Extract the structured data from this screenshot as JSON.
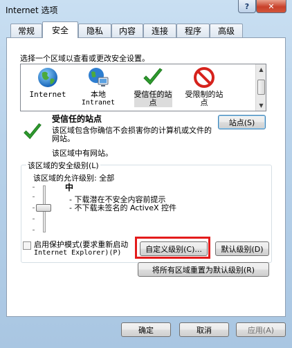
{
  "window": {
    "title": "Internet 选项",
    "help_label": "?",
    "close_label": "✕"
  },
  "tabs": [
    {
      "label": "常规"
    },
    {
      "label": "安全"
    },
    {
      "label": "隐私"
    },
    {
      "label": "内容"
    },
    {
      "label": "连接"
    },
    {
      "label": "程序"
    },
    {
      "label": "高级"
    }
  ],
  "security": {
    "caption": "选择一个区域以查看或更改安全设置。",
    "zones": [
      {
        "label": "Internet",
        "icon": "globe-icon"
      },
      {
        "label1": "本地",
        "label2": "Intranet",
        "icon": "local-intranet-icon"
      },
      {
        "label1": "受信任的站",
        "label2": "点",
        "icon": "checkmark-icon"
      },
      {
        "label1": "受限制的站",
        "label2": "点",
        "icon": "restricted-icon"
      }
    ],
    "selected_zone_title": "受信任的站点",
    "selected_zone_desc": "该区域包含你确信不会损害你的计算机或文件的网站。",
    "no_sites": "该区域中有网站。",
    "sites_button": "站点(S)",
    "level_group_title": "该区域的安全级别(L)",
    "allowed_levels": "该区域的允许级别: 全部",
    "level_name": "中",
    "level_lines": [
      "- 下载潜在不安全内容前提示",
      "- 不下载未签名的 ActiveX 控件"
    ],
    "protected_mode_line1": "启用保护模式(要求重新启动",
    "protected_mode_line2": "Internet Explorer)(P)",
    "custom_level_button": "自定义级别(C)...",
    "default_level_button": "默认级别(D)",
    "reset_all_button": "将所有区域重置为默认级别(R)"
  },
  "footer": {
    "ok": "确定",
    "cancel": "取消",
    "apply": "应用(A)"
  },
  "colors": {
    "accent": "#3c7fb1",
    "highlight_outline": "#e31b1b",
    "check_green": "#2e9a2e",
    "restricted_red": "#d6221c"
  }
}
